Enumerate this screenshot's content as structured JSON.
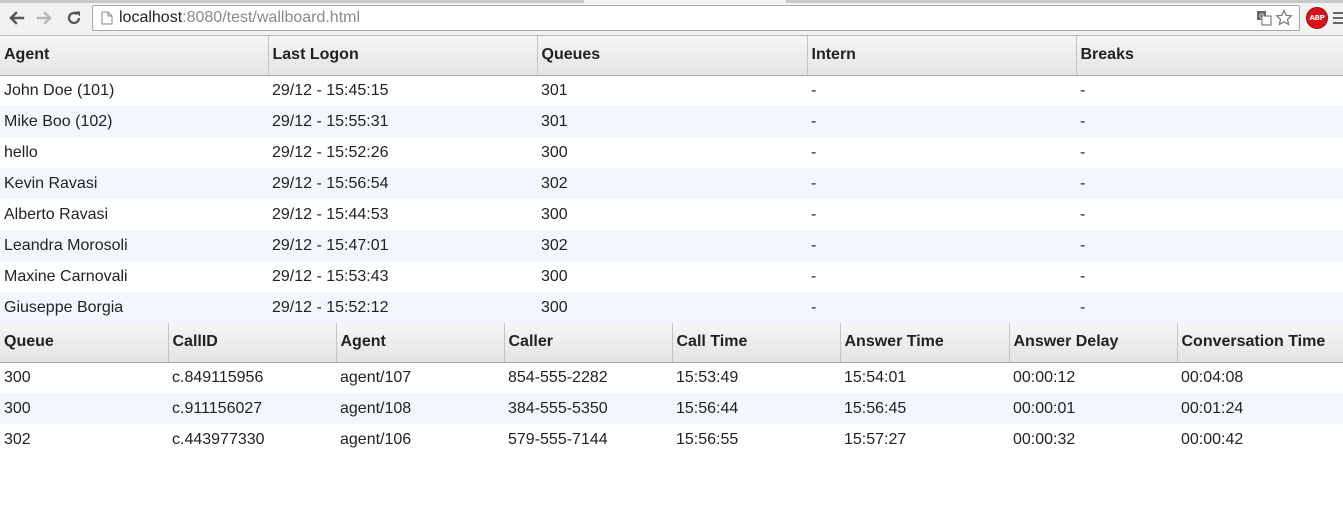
{
  "browser": {
    "url_host": "localhost",
    "url_rest": ":8080/test/wallboard.html",
    "icons": {
      "back": "back-arrow-icon",
      "forward": "forward-arrow-icon",
      "reload": "reload-icon",
      "page": "page-icon",
      "translate": "translate-icon",
      "bookmark": "star-icon",
      "adblock": "abp-icon",
      "menu": "menu-icon"
    },
    "adblock_label": "ABP"
  },
  "agents_table": {
    "headers": [
      "Agent",
      "Last Logon",
      "Queues",
      "Intern",
      "Breaks"
    ],
    "rows": [
      [
        "John Doe (101)",
        "29/12 - 15:45:15",
        "301",
        "-",
        "-"
      ],
      [
        "Mike Boo (102)",
        "29/12 - 15:55:31",
        "301",
        "-",
        "-"
      ],
      [
        "hello",
        "29/12 - 15:52:26",
        "300",
        "-",
        "-"
      ],
      [
        "Kevin Ravasi",
        "29/12 - 15:56:54",
        "302",
        "-",
        "-"
      ],
      [
        "Alberto Ravasi",
        "29/12 - 15:44:53",
        "300",
        "-",
        "-"
      ],
      [
        "Leandra Morosoli",
        "29/12 - 15:47:01",
        "302",
        "-",
        "-"
      ],
      [
        "Maxine Carnovali",
        "29/12 - 15:53:43",
        "300",
        "-",
        "-"
      ],
      [
        "Giuseppe Borgia",
        "29/12 - 15:52:12",
        "300",
        "-",
        "-"
      ]
    ]
  },
  "calls_table": {
    "headers": [
      "Queue",
      "CallID",
      "Agent",
      "Caller",
      "Call Time",
      "Answer Time",
      "Answer Delay",
      "Conversation Time"
    ],
    "rows": [
      [
        "300",
        "c.849115956",
        "agent/107",
        "854-555-2282",
        "15:53:49",
        "15:54:01",
        "00:00:12",
        "00:04:08"
      ],
      [
        "300",
        "c.911156027",
        "agent/108",
        "384-555-5350",
        "15:56:44",
        "15:56:45",
        "00:00:01",
        "00:01:24"
      ],
      [
        "302",
        "c.443977330",
        "agent/106",
        "579-555-7144",
        "15:56:55",
        "15:57:27",
        "00:00:32",
        "00:00:42"
      ]
    ]
  },
  "colors": {
    "row_alt": "#f3f7fd",
    "header_top": "#f6f6f6",
    "header_bottom": "#e4e4e4",
    "adblock": "#d8141a"
  }
}
